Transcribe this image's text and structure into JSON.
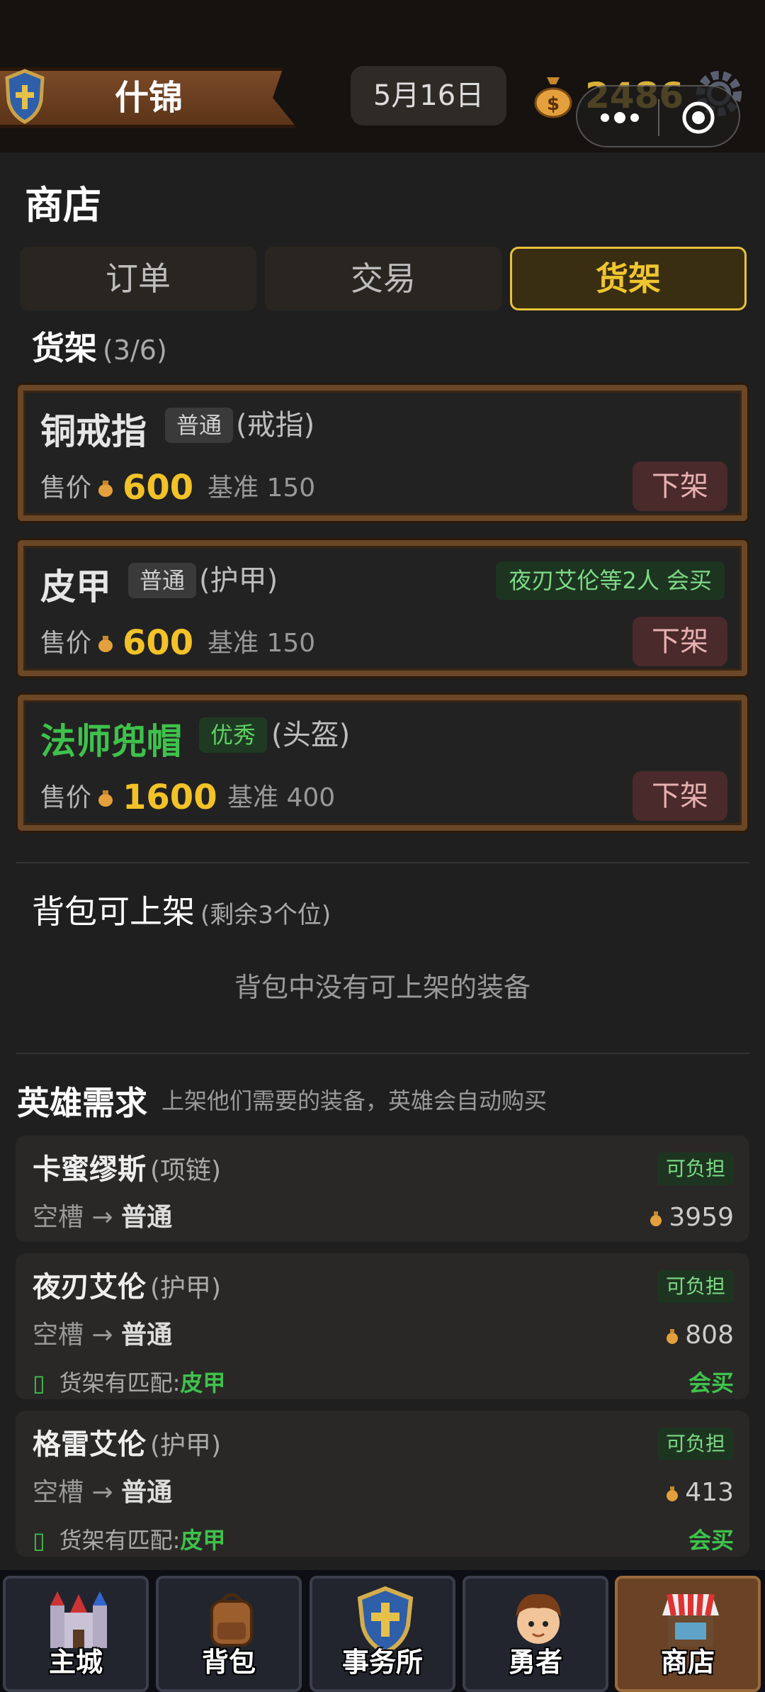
{
  "header": {
    "banner_title": "什锦",
    "date": "5月16日",
    "gold": "2486"
  },
  "shop": {
    "title": "商店",
    "tabs": [
      {
        "label": "订单",
        "active": false
      },
      {
        "label": "交易",
        "active": false
      },
      {
        "label": "货架",
        "active": true
      }
    ]
  },
  "shelf": {
    "title": "货架",
    "count": "(3/6)",
    "price_label": "售价",
    "base_label": "基准",
    "delist_label": "下架",
    "items": [
      {
        "name": "铜戒指",
        "quality": "普通",
        "type": "(戒指)",
        "price": "600",
        "base": "150",
        "buyers": ""
      },
      {
        "name": "皮甲",
        "quality": "普通",
        "type": "(护甲)",
        "price": "600",
        "base": "150",
        "buyers": "夜刃艾伦等2人 会买"
      },
      {
        "name": "法师兜帽",
        "quality": "优秀",
        "type": "(头盔)",
        "price": "1600",
        "base": "400",
        "buyers": ""
      }
    ]
  },
  "backpack": {
    "title": "背包可上架",
    "remaining": "(剩余3个位)",
    "empty_message": "背包中没有可上架的装备"
  },
  "hero_needs": {
    "title": "英雄需求",
    "hint": "上架他们需要的装备，英雄会自动购买",
    "afford_label": "可负担",
    "slot_label": "空槽 →",
    "match_label": "货架有匹配:",
    "will_buy_label": "会买",
    "heroes": [
      {
        "name": "卡蜜缪斯",
        "type": "(项链)",
        "target": "普通",
        "gold": "3959",
        "match": ""
      },
      {
        "name": "夜刃艾伦",
        "type": "(护甲)",
        "target": "普通",
        "gold": "808",
        "match": "皮甲"
      },
      {
        "name": "格雷艾伦",
        "type": "(护甲)",
        "target": "普通",
        "gold": "413",
        "match": "皮甲"
      }
    ]
  },
  "nav": {
    "items": [
      {
        "label": "主城",
        "icon": "castle-icon"
      },
      {
        "label": "背包",
        "icon": "backpack-icon"
      },
      {
        "label": "事务所",
        "icon": "shield-icon"
      },
      {
        "label": "勇者",
        "icon": "hero-face-icon"
      },
      {
        "label": "商店",
        "icon": "shop-stall-icon",
        "active": true
      }
    ]
  },
  "colors": {
    "gold": "#f2c228",
    "accent_tab": "#e8c23c",
    "uncommon_green": "#3ec24c",
    "frame_brown": "#6a4727"
  }
}
